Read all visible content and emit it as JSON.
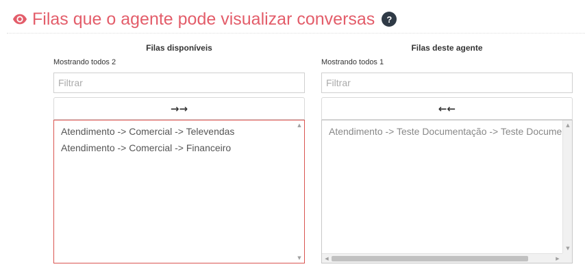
{
  "header": {
    "title": "Filas que o agente pode visualizar conversas",
    "help_glyph": "?",
    "icons": {
      "title_icon": "eye-icon",
      "help_icon": "question-circle-icon"
    },
    "colors": {
      "title": "#e35d6a",
      "help_bg": "#2f3a46",
      "invalid_border": "#d9534f"
    }
  },
  "available": {
    "heading": "Filas disponíveis",
    "count_label": "Mostrando todos 2",
    "filter_placeholder": "Filtrar",
    "move_button": "→→",
    "items": [
      "Atendimento -> Comercial -> Televendas",
      "Atendimento -> Comercial -> Financeiro"
    ]
  },
  "selected": {
    "heading": "Filas deste agente",
    "count_label": "Mostrando todos 1",
    "filter_placeholder": "Filtrar",
    "move_button": "←←",
    "items": [
      "Atendimento -> Teste Documentação -> Teste Documentação"
    ]
  }
}
